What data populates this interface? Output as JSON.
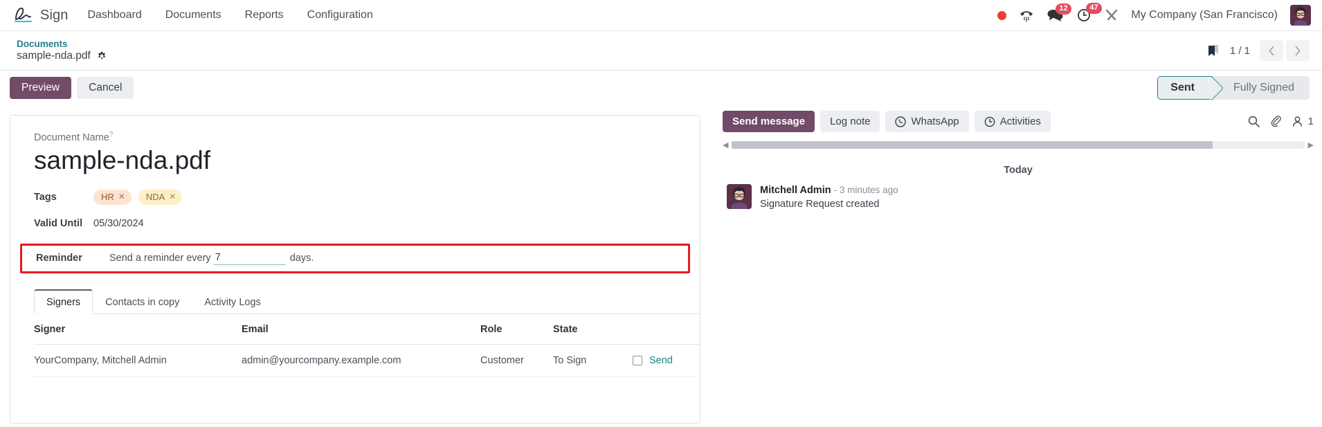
{
  "navbar": {
    "brand": "Sign",
    "brand_logo_icon": "signature-logo-icon",
    "links": [
      "Dashboard",
      "Documents",
      "Reports",
      "Configuration"
    ],
    "status_dot_icon": "recording-dot-icon",
    "phone_icon": "dialpad-phone-icon",
    "messages_icon": "chat-bubble-icon",
    "messages_badge": "12",
    "activities_icon": "clock-activity-icon",
    "activities_badge": "47",
    "debug_icon": "tools-debug-icon",
    "company": "My Company (San Francisco)",
    "avatar_icon": "user-avatar"
  },
  "breadcrumb": {
    "parent": "Documents",
    "current": "sample-nda.pdf",
    "gear_icon": "gear-icon",
    "bookmark_icon": "bookmark-icon",
    "pager": "1 / 1",
    "prev_icon": "chevron-left-icon",
    "next_icon": "chevron-right-icon"
  },
  "controls": {
    "preview_label": "Preview",
    "cancel_label": "Cancel",
    "status_current": "Sent",
    "status_next": "Fully Signed"
  },
  "form": {
    "doc_name_label": "Document Name",
    "doc_name_help": "?",
    "doc_name_value": "sample-nda.pdf",
    "tags_label": "Tags",
    "tags": [
      {
        "label": "HR",
        "remove_icon": "tag-remove-icon"
      },
      {
        "label": "NDA",
        "remove_icon": "tag-remove-icon"
      }
    ],
    "valid_until_label": "Valid Until",
    "valid_until_value": "05/30/2024",
    "reminder_label": "Reminder",
    "reminder_prefix": "Send a reminder every",
    "reminder_value": "7",
    "reminder_suffix": "days."
  },
  "tabs": [
    {
      "label": "Signers",
      "active": true
    },
    {
      "label": "Contacts in copy",
      "active": false
    },
    {
      "label": "Activity Logs",
      "active": false
    }
  ],
  "signers_table": {
    "columns": [
      "Signer",
      "Email",
      "Role",
      "State",
      ""
    ],
    "rows": [
      {
        "signer": "YourCompany, Mitchell Admin",
        "email": "admin@yourcompany.example.com",
        "role": "Customer",
        "state": "To Sign",
        "checkbox_icon": "checkbox-unchecked-icon",
        "action": "Send"
      }
    ]
  },
  "chatter": {
    "send_message_label": "Send message",
    "log_note_label": "Log note",
    "whatsapp_label": "WhatsApp",
    "whatsapp_icon": "whatsapp-icon",
    "activities_label": "Activities",
    "activities_icon": "clock-icon",
    "search_icon": "search-icon",
    "attachment_icon": "paperclip-icon",
    "followers_icon": "user-follower-icon",
    "followers_count": "1",
    "today_label": "Today",
    "messages": [
      {
        "author": "Mitchell Admin",
        "time": "- 3 minutes ago",
        "body": "Signature Request created",
        "avatar_icon": "user-avatar"
      }
    ]
  }
}
